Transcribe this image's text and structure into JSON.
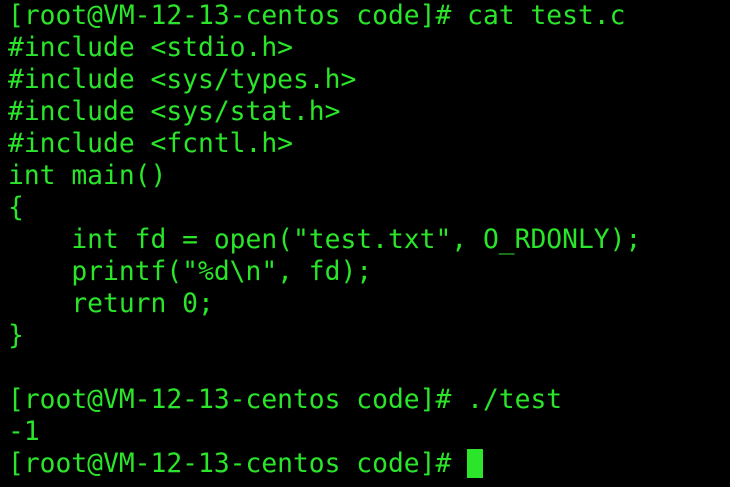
{
  "theme": {
    "background": "#000000",
    "foreground": "#2AE52A"
  },
  "terminal": {
    "lines": [
      "[root@VM-12-13-centos code]# cat test.c",
      "#include <stdio.h>",
      "#include <sys/types.h>",
      "#include <sys/stat.h>",
      "#include <fcntl.h>",
      "int main()",
      "{",
      "    int fd = open(\"test.txt\", O_RDONLY);",
      "    printf(\"%d\\n\", fd);",
      "    return 0;",
      "}",
      "",
      "[root@VM-12-13-centos code]# ./test",
      "-1"
    ],
    "prompt": "[root@VM-12-13-centos code]#",
    "cursor_glyph": "block-cursor"
  }
}
